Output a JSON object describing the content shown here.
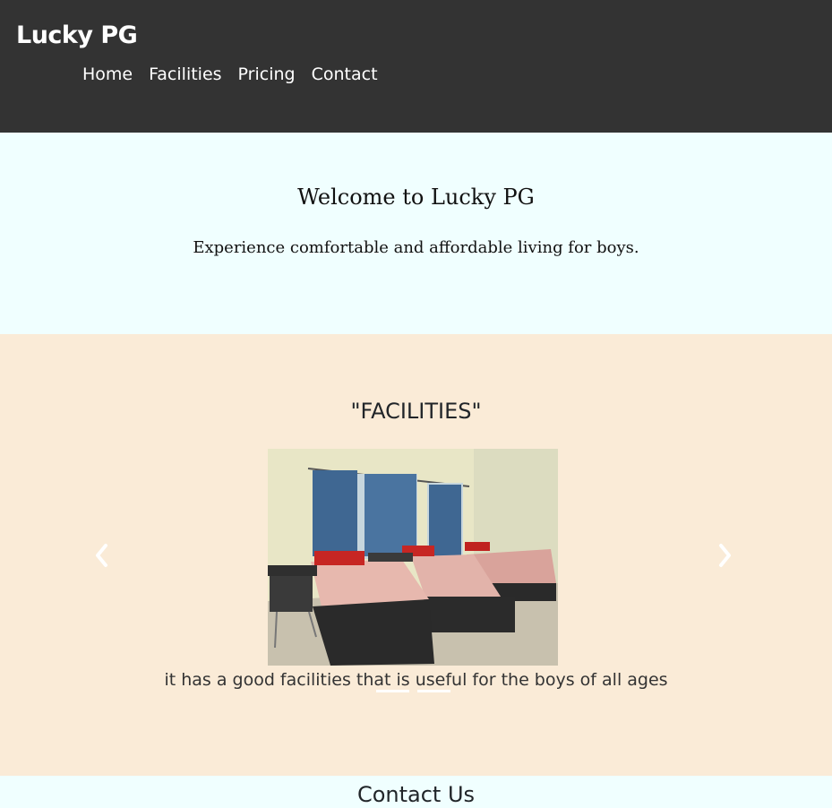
{
  "header": {
    "brand": "Lucky PG",
    "nav": [
      "Home",
      "Facilities",
      "Pricing",
      "Contact"
    ]
  },
  "hero": {
    "title": "Welcome to Lucky PG",
    "subtitle": "Experience comfortable and affordable living for boys."
  },
  "facilities": {
    "title": "\"FACILITIES\"",
    "caption": "it has a good facilities that is useful for the boys of all ages",
    "prev_icon": "chevron-left-icon",
    "next_icon": "chevron-right-icon"
  },
  "contact": {
    "title": "Contact Us"
  },
  "colors": {
    "navbar": "#333333",
    "hero_bg": "#f0ffff",
    "facilities_bg": "#faebd7"
  }
}
